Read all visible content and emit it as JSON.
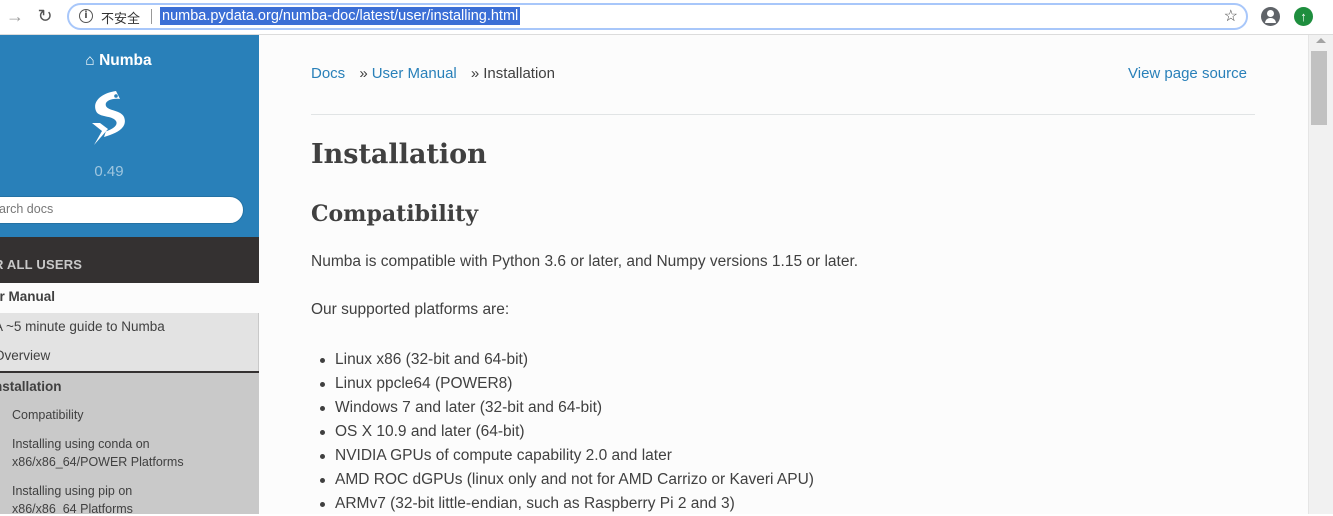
{
  "browser": {
    "insecure_label": "不安全",
    "url": "numba.pydata.org/numba-doc/latest/user/installing.html"
  },
  "sidebar": {
    "project": "Numba",
    "version": "0.49",
    "search_placeholder": "arch docs",
    "caption": "R ALL USERS",
    "l1": "er Manual",
    "l2": [
      "A ~5 minute guide to Numba",
      "Overview",
      "nstallation"
    ],
    "l3": [
      "Compatibility",
      "Installing using conda on",
      "x86/x86_64/POWER Platforms",
      "Installing using pip on",
      "x86/x86_64 Platforms"
    ]
  },
  "breadcrumb": {
    "docs": "Docs",
    "sep1": "»",
    "user_manual": "User Manual",
    "sep2": "»",
    "current": "Installation"
  },
  "view_source": "View page source",
  "content": {
    "title": "Installation",
    "section": "Compatibility",
    "para1": "Numba is compatible with Python 3.6 or later, and Numpy versions 1.15 or later.",
    "para2": "Our supported platforms are:",
    "platforms": [
      "Linux x86 (32-bit and 64-bit)",
      "Linux ppcle64 (POWER8)",
      "Windows 7 and later (32-bit and 64-bit)",
      "OS X 10.9 and later (64-bit)",
      "NVIDIA GPUs of compute capability 2.0 and later",
      "AMD ROC dGPUs (linux only and not for AMD Carrizo or Kaveri APU)",
      "ARMv7 (32-bit little-endian, such as Raspberry Pi 2 and 3)"
    ]
  }
}
